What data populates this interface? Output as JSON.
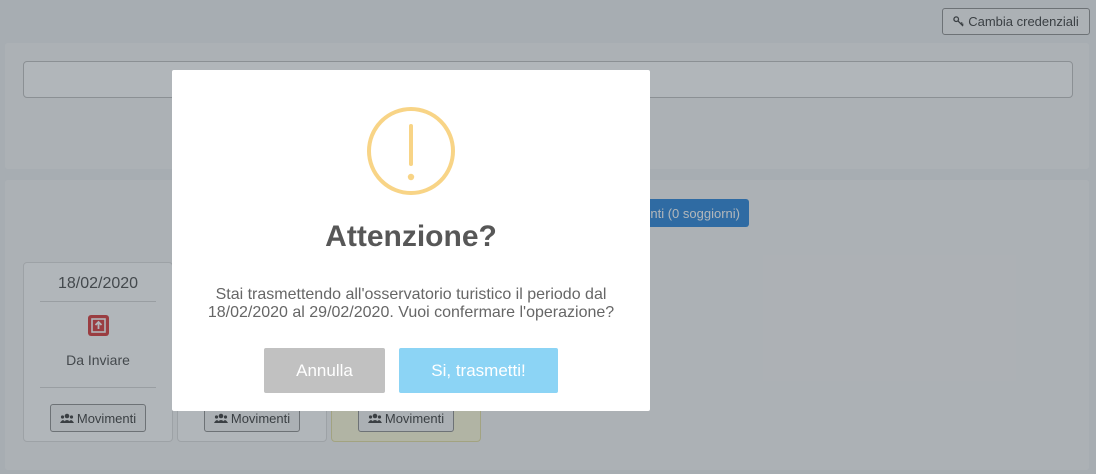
{
  "header": {
    "credentials_button": "Cambia credenziali"
  },
  "summary_button": "nti (0 soggiorni)",
  "cards": [
    {
      "date": "18/02/2020",
      "status": "Da Inviare",
      "button": "Movimenti"
    },
    {
      "button": "Movimenti"
    },
    {
      "button": "Movimenti"
    }
  ],
  "modal": {
    "title": "Attenzione?",
    "message_line1": "Stai trasmettendo all'osservatorio turistico il periodo dal",
    "message_line2": "18/02/2020 al 29/02/2020. Vuoi confermare l'operazione?",
    "cancel_label": "Annulla",
    "confirm_label": "Si, trasmetti!"
  },
  "colors": {
    "warning_icon": "#f8d486",
    "confirm_button": "#8cd4f5",
    "cancel_button": "#c1c1c1",
    "primary_button": "#1f7fd8",
    "status_icon": "#d72f2f"
  },
  "icons": {
    "credentials": "key-icon",
    "movimenti": "users-icon",
    "status": "upload-box-icon",
    "modal": "warning-circle-icon"
  }
}
